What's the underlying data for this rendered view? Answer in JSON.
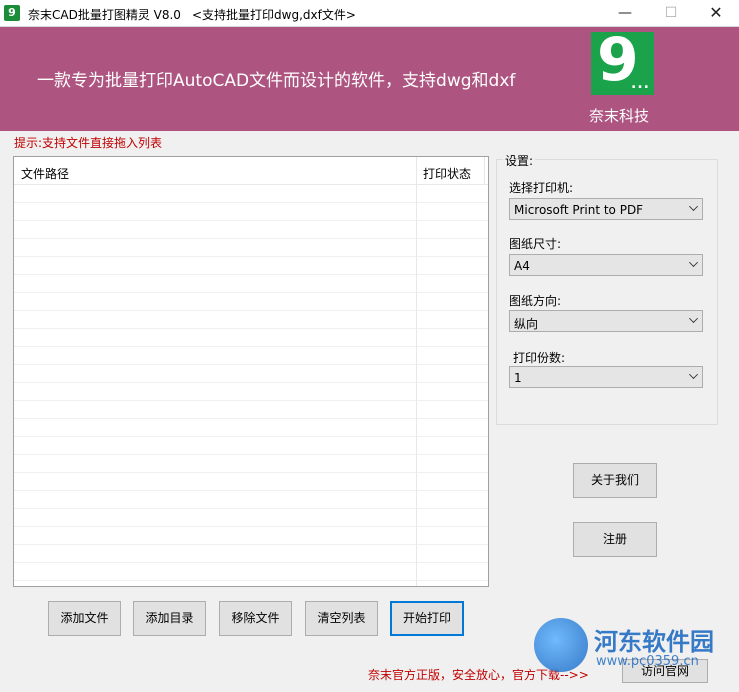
{
  "window": {
    "title": "奈末CAD批量打图精灵 V8.0",
    "subtitle": "<支持批量打印dwg,dxf文件>",
    "minimize_glyph": "—",
    "maximize_glyph": "☐",
    "close_glyph": "✕"
  },
  "banner": {
    "slogan": "一款专为批量打印AutoCAD文件而设计的软件，支持dwg和dxf",
    "logo_digit": "9",
    "logo_dots": "...",
    "company": "奈末科技",
    "background": "#ad5580"
  },
  "hint": "提示:支持文件直接拖入列表",
  "file_list": {
    "columns": [
      "文件路径",
      "打印状态"
    ],
    "rows": []
  },
  "settings": {
    "title": "设置:",
    "printer_label": "选择打印机:",
    "printer_value": "Microsoft Print to PDF",
    "paper_size_label": "图纸尺寸:",
    "paper_size_value": "A4",
    "orientation_label": "图纸方向:",
    "orientation_value": "纵向",
    "copies_label": "打印份数:",
    "copies_value": "1"
  },
  "buttons": {
    "about": "关于我们",
    "register": "注册",
    "add_file": "添加文件",
    "add_folder": "添加目录",
    "remove_file": "移除文件",
    "clear_list": "清空列表",
    "start_print": "开始打印",
    "visit_site": "访问官网"
  },
  "footer": {
    "text": "奈末官方正版，安全放心，官方下载-->>"
  },
  "watermark": {
    "name": "河东软件园",
    "url": "www.pc0359.cn"
  }
}
